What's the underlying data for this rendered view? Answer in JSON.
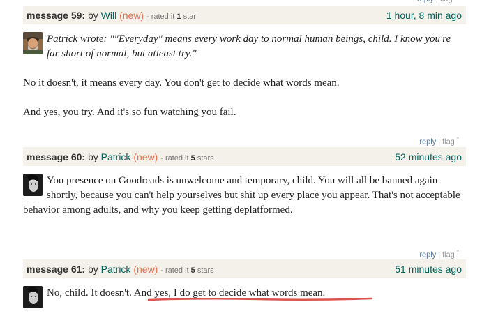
{
  "top_actions": {
    "reply": "reply",
    "sep": "|",
    "flag": "flag"
  },
  "messages": [
    {
      "label": "message 59:",
      "by": "by",
      "author": "Will",
      "new": "(new)",
      "rated_prefix": "- rated it",
      "rated_value": "1",
      "rated_suffix": "star",
      "time": "1 hour, 8 min ago",
      "quote": "Patrick wrote: \"\"Everyday\" means every work day to normal human beings, child. I know you're far short of normal, but atleast try.\"",
      "paragraphs": [
        "No it doesn't, it means every day. You don't get to decide what words mean.",
        "And yes, you try. And it's so fun watching you fail."
      ],
      "actions": {
        "reply": "reply",
        "sep": "|",
        "flag": "flag",
        "flag_mark": "*"
      }
    },
    {
      "label": "message 60:",
      "by": "by",
      "author": "Patrick",
      "new": "(new)",
      "rated_prefix": "- rated it",
      "rated_value": "5",
      "rated_suffix": "stars",
      "time": "52 minutes ago",
      "body": "You presence on Goodreads is unwelcome and temporary, child. You will all be banned again shortly, because you can't help yourselves but shit up every place you appear. That's not acceptable behavior among adults, and why you keep getting deplatformed.",
      "actions": {
        "reply": "reply",
        "sep": "|",
        "flag": "flag",
        "flag_mark": "*"
      }
    },
    {
      "label": "message 61:",
      "by": "by",
      "author": "Patrick",
      "new": "(new)",
      "rated_prefix": "- rated it",
      "rated_value": "5",
      "rated_suffix": "stars",
      "time": "51 minutes ago",
      "body_start": "No, child. It doesn't.",
      "body_highlight": "And yes, I do get to decide what words mean."
    }
  ],
  "colors": {
    "header_bg": "#f4f1ea",
    "author": "#00635d",
    "new_tag": "#e8714d",
    "highlight_underline": "#d9534f"
  }
}
